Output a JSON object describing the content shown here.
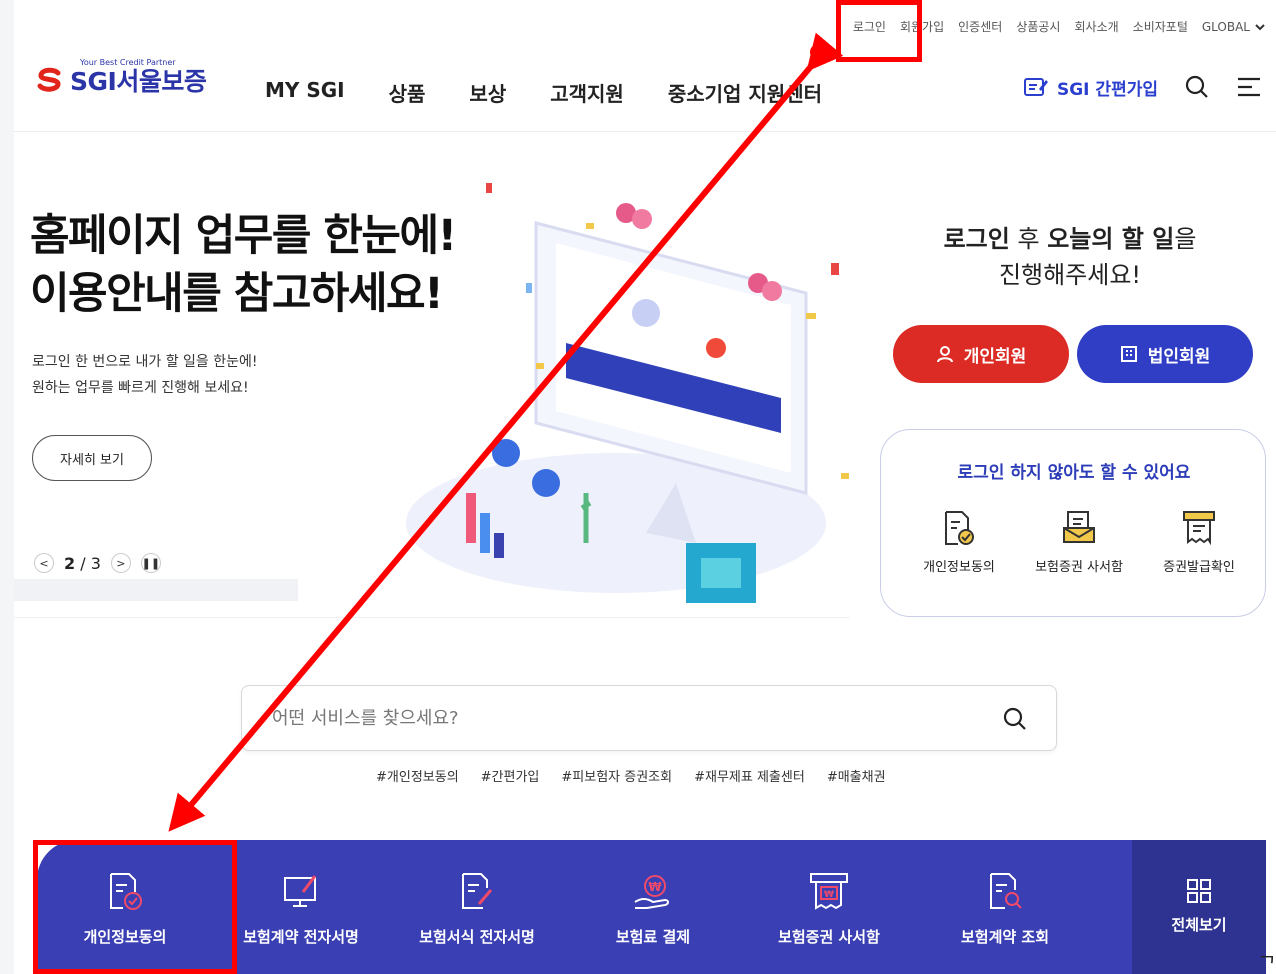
{
  "utility_nav": [
    "로그인",
    "회원가입",
    "인증센터",
    "상품공시",
    "회사소개",
    "소비자포털",
    "GLOBAL"
  ],
  "logo": {
    "tagline": "Your Best Credit Partner",
    "text": "SGI서울보증"
  },
  "gnb": [
    "MY SGI",
    "상품",
    "보상",
    "고객지원",
    "중소기업 지원센터"
  ],
  "header_right": {
    "quick_join": "SGI 간편가입"
  },
  "hero": {
    "title_line1": "홈페이지 업무를 한눈에!",
    "title_line2": "이용안내를 참고하세요!",
    "desc_line1": "로그인 한 번으로 내가 할 일을 한눈에!",
    "desc_line2": "원하는 업무를 빠르게 진행해 보세요!",
    "detail_button": "자세히 보기",
    "page_current": "2",
    "page_total": "/ 3"
  },
  "login_panel": {
    "msg_bold1": "로그인",
    "msg_mid1": " 후 ",
    "msg_bold2": "오늘의 할 일",
    "msg_end1": "을",
    "msg_line2": "진행해주세요!",
    "personal_button": "개인회원",
    "corporate_button": "법인회원",
    "nologin_title": "로그인 하지 않아도 할 수 있어요",
    "nologin_items": [
      "개인정보동의",
      "보험증권 사서함",
      "증권발급확인"
    ]
  },
  "search": {
    "placeholder": "어떤 서비스를 찾으세요?",
    "tags": [
      "#개인정보동의",
      "#간편가입",
      "#피보험자 증권조회",
      "#재무제표 제출센터",
      "#매출채권"
    ]
  },
  "quick_services": [
    "개인정보동의",
    "보험계약 전자서명",
    "보험서식 전자서명",
    "보험료 결제",
    "보험증권 사서함",
    "보험계약 조회"
  ],
  "view_all": "전체보기",
  "edge_char": "ᄀ",
  "colors": {
    "brand_blue": "#2b35a8",
    "quick_bar": "#3a3fb3",
    "red_button": "#dc2b24",
    "annotation_red": "#ff0000"
  }
}
